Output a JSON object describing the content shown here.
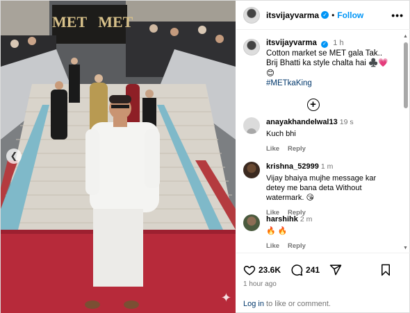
{
  "post": {
    "username": "itsvijayvarma",
    "follow_label": "Follow",
    "more_label": "•••",
    "caption_time": "1 h",
    "caption_line1": "Cotton market se MET gala Tak.. Brij Bhatti ka style chalta hai ",
    "caption_emoji": "♣️💗😊",
    "hashtag": "#METkaKing",
    "sign_text": "MET   MET"
  },
  "comments": [
    {
      "user": "anayakhandelwal13",
      "time": "19 s",
      "text": "Kuch bhi",
      "like": "Like",
      "reply": "Reply"
    },
    {
      "user": "krishna_52999",
      "time": "1 m",
      "text": "Vijay bhaiya mujhe message kar detey me bana deta Without watermark. 😘",
      "like": "Like",
      "reply": "Reply"
    },
    {
      "user": "harshihk",
      "time": "2 m",
      "text": "🔥 🔥",
      "like": "Like",
      "reply": "Reply"
    }
  ],
  "stats": {
    "likes": "23.6K",
    "comments": "241"
  },
  "time_ago": "1 hour ago",
  "login": {
    "link": "Log in",
    "rest": " to like or comment."
  },
  "icons": [
    "chevron-left-icon",
    "verified-icon",
    "more-icon",
    "add-comment-icon",
    "heart-icon",
    "comment-icon",
    "share-icon",
    "bookmark-icon",
    "sparkle-icon"
  ],
  "colors": {
    "accent": "#0095f6",
    "link": "#00376b",
    "muted": "#737373",
    "carpet": "#b72a3a"
  }
}
